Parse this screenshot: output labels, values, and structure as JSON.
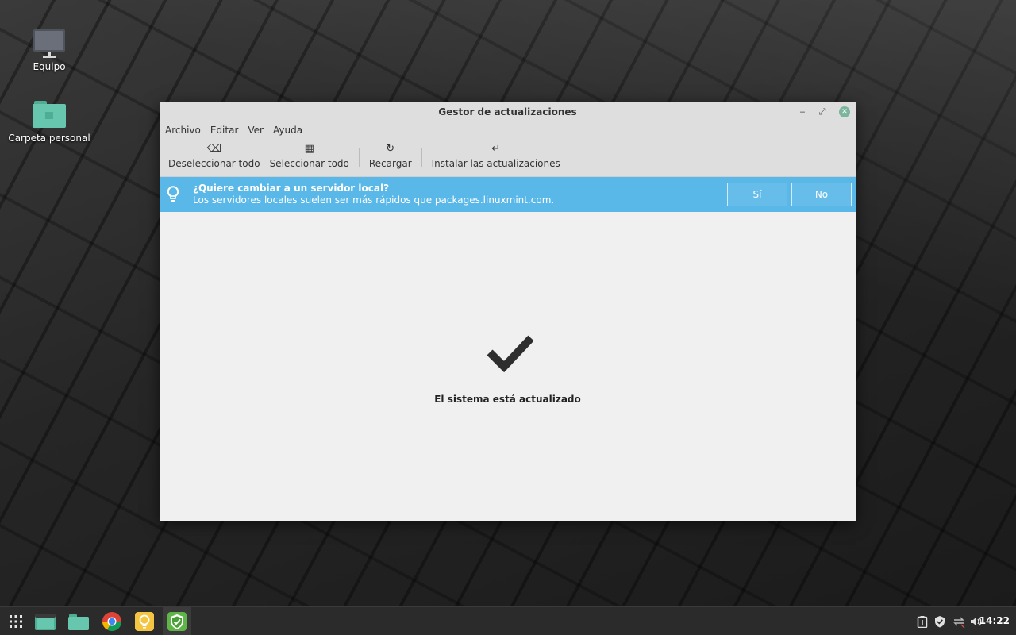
{
  "desktop": {
    "icons": [
      {
        "label": "Equipo",
        "icon": "computer-icon"
      },
      {
        "label": "Carpeta personal",
        "icon": "home-folder-icon"
      }
    ]
  },
  "window": {
    "title": "Gestor de actualizaciones",
    "controls": {
      "minimize": "‒",
      "maximize": "⤢",
      "close": "✕"
    },
    "menu": [
      "Archivo",
      "Editar",
      "Ver",
      "Ayuda"
    ],
    "toolbar": {
      "deselect_all": {
        "icon": "⌫",
        "label": "Deseleccionar todo"
      },
      "select_all": {
        "icon": "▦",
        "label": "Seleccionar todo"
      },
      "reload": {
        "icon": "↻",
        "label": "Recargar"
      },
      "install": {
        "icon": "↵",
        "label": "Instalar las actualizaciones"
      }
    },
    "infobar": {
      "question": "¿Quiere cambiar a un servidor local?",
      "detail": "Los servidores locales suelen ser más rápidos que packages.linuxmint.com.",
      "yes_label": "Sí",
      "no_label": "No",
      "color": "#5ab8e8"
    },
    "status": "El sistema está actualizado"
  },
  "taskbar": {
    "accent": "#6bbf9e",
    "launchers": [
      "apps-grid-icon",
      "terminal-icon",
      "files-icon",
      "chrome-icon",
      "lightbulb-icon",
      "shield-update-icon"
    ],
    "tray": [
      "clipboard-icon",
      "shield-icon",
      "network-icon",
      "volume-icon"
    ],
    "clock": "14:22"
  }
}
